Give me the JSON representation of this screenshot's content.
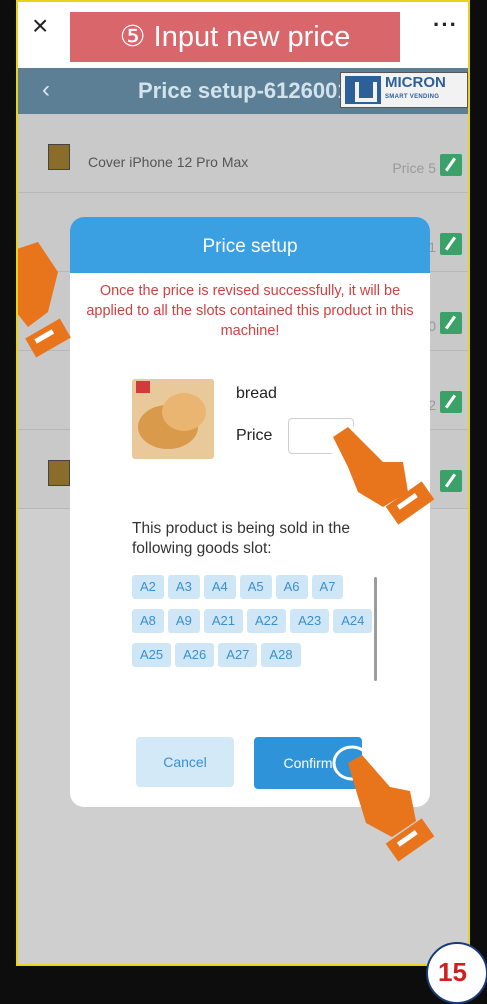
{
  "topbar": {
    "close_glyph": "×",
    "more_glyph": "···"
  },
  "banner": {
    "text": "⑤ Input new price",
    "color": "#d9666a"
  },
  "header": {
    "back_glyph": "‹",
    "title": "Price setup-6126001",
    "logo_text": "MICRON",
    "logo_sub": "SMART VENDING"
  },
  "list": {
    "rows": [
      {
        "name": "Cover iPhone 12 Pro Max",
        "price": "Price 5"
      },
      {
        "name": "",
        "price": "1"
      },
      {
        "name": "",
        "price": "0"
      },
      {
        "name": "",
        "price": "2"
      },
      {
        "name": "",
        "price": ""
      }
    ]
  },
  "modal": {
    "title": "Price setup",
    "warning": "Once the price is revised successfully, it will be applied to all the slots contained this product in this machine!",
    "product_name": "bread",
    "price_label": "Price",
    "price_value": "",
    "slots_title": "This product is being sold in the following goods slot:",
    "slots": [
      "A2",
      "A3",
      "A4",
      "A5",
      "A6",
      "A7",
      "A8",
      "A9",
      "A21",
      "A22",
      "A23",
      "A24",
      "A25",
      "A26",
      "A27",
      "A28"
    ],
    "cancel_label": "Cancel",
    "confirm_label": "Confirm"
  },
  "page_number": "15",
  "colors": {
    "accent": "#3aa0e2",
    "warning": "#d3403f",
    "hand": "#e8741c",
    "frame": "#e9d21a"
  }
}
